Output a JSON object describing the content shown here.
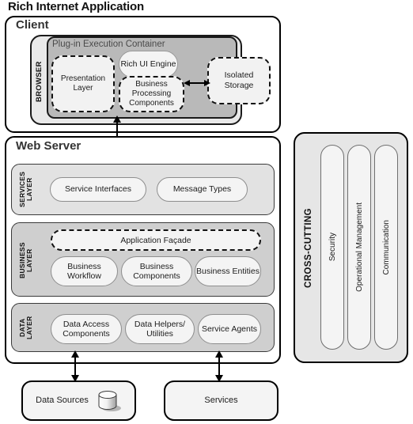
{
  "diagram": {
    "title": "Rich Internet Application"
  },
  "client": {
    "label": "Client",
    "browser": {
      "label": "BROWSER",
      "plugin_container": {
        "title": "Plug-in Execution Container",
        "components": [
          {
            "name": "Presentation Layer",
            "style": "dashed"
          },
          {
            "name": "Rich UI Engine",
            "style": "pill"
          },
          {
            "name": "Business Processing Components",
            "style": "dashed"
          }
        ]
      }
    },
    "isolated_storage": {
      "label": "Isolated Storage",
      "style": "dashed"
    }
  },
  "arrows": {
    "isolated_storage_link": "bidirectional",
    "client_server_link": "bidirectional",
    "data_sources_link": "bidirectional",
    "services_link": "bidirectional"
  },
  "web_server": {
    "label": "Web Server",
    "layers": [
      {
        "label": "SERVICES LAYER",
        "label_lines": [
          "SERVICES",
          "LAYER"
        ],
        "shade": "light",
        "items": [
          "Service Interfaces",
          "Message Types"
        ]
      },
      {
        "label": "BUSINESS LAYER",
        "label_lines": [
          "BUSINESS",
          "LAYER"
        ],
        "shade": "mid",
        "facade": "Application Façade",
        "items": [
          "Business Workflow",
          "Business Components",
          "Business Entities"
        ]
      },
      {
        "label": "DATA LAYER",
        "label_lines": [
          "DATA",
          "LAYER"
        ],
        "shade": "mid",
        "items": [
          "Data Access Components",
          "Data Helpers/ Utilities",
          "Service Agents"
        ]
      }
    ]
  },
  "external": [
    {
      "label": "Data Sources",
      "icon": "database-cylinder-icon"
    },
    {
      "label": "Services",
      "icon": null
    }
  ],
  "cross_cutting": {
    "label": "CROSS-CUTTING",
    "items": [
      "Security",
      "Operational Management",
      "Communication"
    ]
  },
  "colors": {
    "page_background": "#ffffff",
    "outline": "#000000",
    "browser_fill": "#e9e9e9",
    "plugin_fill": "#b9b9b9",
    "layer_light_fill": "#e2e2e2",
    "layer_mid_fill": "#cfcfcf",
    "pill_fill": "#f4f4f4",
    "cross_cutting_fill": "#e6e6e6"
  }
}
